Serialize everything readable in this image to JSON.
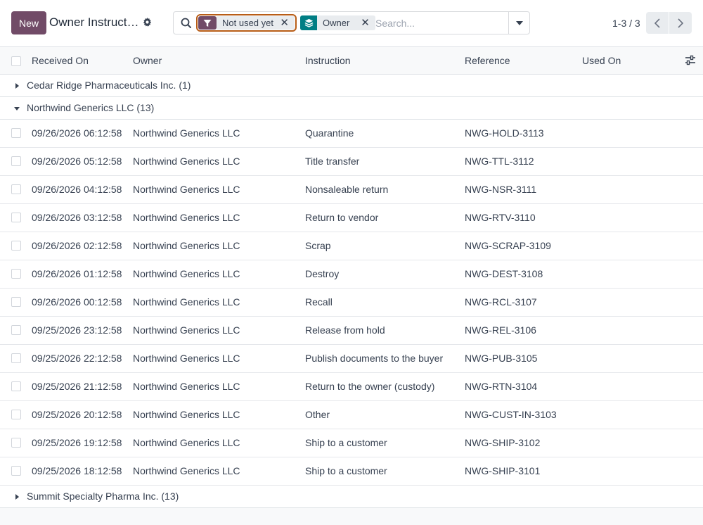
{
  "control_panel": {
    "new_label": "New",
    "title": "Owner Instruct…",
    "search": {
      "placeholder": "Search...",
      "facets": [
        {
          "label": "Not used yet",
          "icon": "filter-icon",
          "color": "#714b67"
        },
        {
          "label": "Owner",
          "icon": "layers-icon",
          "color": "#017e84"
        }
      ]
    },
    "pager": {
      "value": "1-3 / 3"
    }
  },
  "colors": {
    "brand": "#714b67",
    "groupby_facet": "#017e84",
    "highlight_border": "#b85d17"
  },
  "table": {
    "columns": [
      "Received On",
      "Owner",
      "Instruction",
      "Reference",
      "Used On"
    ],
    "groups": [
      {
        "label": "Cedar Ridge Pharmaceuticals Inc. (1)",
        "expanded": false,
        "rows": []
      },
      {
        "label": "Northwind Generics LLC (13)",
        "expanded": true,
        "rows": [
          {
            "received": "09/26/2026 06:12:58",
            "owner": "Northwind Generics LLC",
            "instruction": "Quarantine",
            "reference": "NWG-HOLD-3113",
            "used_on": ""
          },
          {
            "received": "09/26/2026 05:12:58",
            "owner": "Northwind Generics LLC",
            "instruction": "Title transfer",
            "reference": "NWG-TTL-3112",
            "used_on": ""
          },
          {
            "received": "09/26/2026 04:12:58",
            "owner": "Northwind Generics LLC",
            "instruction": "Nonsaleable return",
            "reference": "NWG-NSR-3111",
            "used_on": ""
          },
          {
            "received": "09/26/2026 03:12:58",
            "owner": "Northwind Generics LLC",
            "instruction": "Return to vendor",
            "reference": "NWG-RTV-3110",
            "used_on": ""
          },
          {
            "received": "09/26/2026 02:12:58",
            "owner": "Northwind Generics LLC",
            "instruction": "Scrap",
            "reference": "NWG-SCRAP-3109",
            "used_on": ""
          },
          {
            "received": "09/26/2026 01:12:58",
            "owner": "Northwind Generics LLC",
            "instruction": "Destroy",
            "reference": "NWG-DEST-3108",
            "used_on": ""
          },
          {
            "received": "09/26/2026 00:12:58",
            "owner": "Northwind Generics LLC",
            "instruction": "Recall",
            "reference": "NWG-RCL-3107",
            "used_on": ""
          },
          {
            "received": "09/25/2026 23:12:58",
            "owner": "Northwind Generics LLC",
            "instruction": "Release from hold",
            "reference": "NWG-REL-3106",
            "used_on": ""
          },
          {
            "received": "09/25/2026 22:12:58",
            "owner": "Northwind Generics LLC",
            "instruction": "Publish documents to the buyer",
            "reference": "NWG-PUB-3105",
            "used_on": ""
          },
          {
            "received": "09/25/2026 21:12:58",
            "owner": "Northwind Generics LLC",
            "instruction": "Return to the owner (custody)",
            "reference": "NWG-RTN-3104",
            "used_on": ""
          },
          {
            "received": "09/25/2026 20:12:58",
            "owner": "Northwind Generics LLC",
            "instruction": "Other",
            "reference": "NWG-CUST-IN-3103",
            "used_on": ""
          },
          {
            "received": "09/25/2026 19:12:58",
            "owner": "Northwind Generics LLC",
            "instruction": "Ship to a customer",
            "reference": "NWG-SHIP-3102",
            "used_on": ""
          },
          {
            "received": "09/25/2026 18:12:58",
            "owner": "Northwind Generics LLC",
            "instruction": "Ship to a customer",
            "reference": "NWG-SHIP-3101",
            "used_on": ""
          }
        ]
      },
      {
        "label": "Summit Specialty Pharma Inc. (13)",
        "expanded": false,
        "rows": []
      }
    ]
  }
}
